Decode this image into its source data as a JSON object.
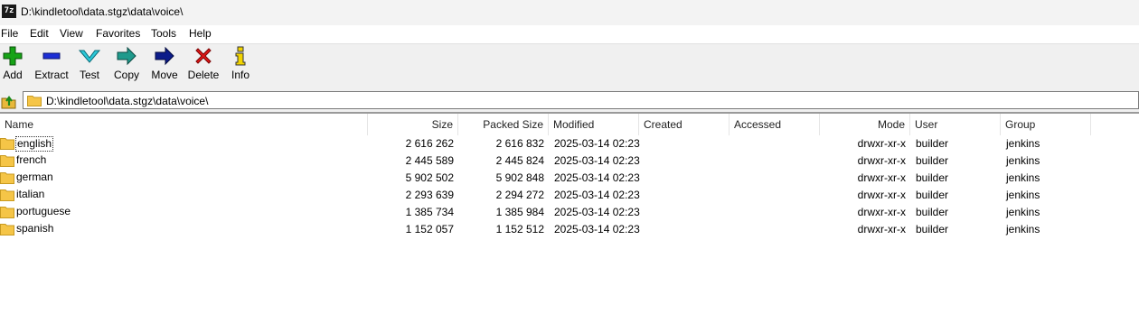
{
  "window": {
    "icon_text": "7z",
    "title": "D:\\kindletool\\data.stgz\\data\\voice\\"
  },
  "menu": [
    "File",
    "Edit",
    "View",
    "Favorites",
    "Tools",
    "Help"
  ],
  "toolbar": [
    {
      "label": "Add",
      "icon": "plus-icon",
      "color": "#16a316"
    },
    {
      "label": "Extract",
      "icon": "minus-icon",
      "color": "#1d2fd6"
    },
    {
      "label": "Test",
      "icon": "checkmark-icon",
      "color": "#2bc8d8"
    },
    {
      "label": "Copy",
      "icon": "copy-arrow-icon",
      "color": "#1f9a8c"
    },
    {
      "label": "Move",
      "icon": "move-arrow-icon",
      "color": "#0c1c8a"
    },
    {
      "label": "Delete",
      "icon": "delete-x-icon",
      "color": "#e01414"
    },
    {
      "label": "Info",
      "icon": "info-icon",
      "color": "#f2d400"
    }
  ],
  "address": {
    "path": "D:\\kindletool\\data.stgz\\data\\voice\\"
  },
  "columns": [
    "Name",
    "Size",
    "Packed Size",
    "Modified",
    "Created",
    "Accessed",
    "Mode",
    "User",
    "Group"
  ],
  "rows": [
    {
      "name": "english",
      "size": "2 616 262",
      "packed": "2 616 832",
      "modified": "2025-03-14 02:23",
      "created": "",
      "accessed": "",
      "mode": "drwxr-xr-x",
      "user": "builder",
      "group": "jenkins"
    },
    {
      "name": "french",
      "size": "2 445 589",
      "packed": "2 445 824",
      "modified": "2025-03-14 02:23",
      "created": "",
      "accessed": "",
      "mode": "drwxr-xr-x",
      "user": "builder",
      "group": "jenkins"
    },
    {
      "name": "german",
      "size": "5 902 502",
      "packed": "5 902 848",
      "modified": "2025-03-14 02:23",
      "created": "",
      "accessed": "",
      "mode": "drwxr-xr-x",
      "user": "builder",
      "group": "jenkins"
    },
    {
      "name": "italian",
      "size": "2 293 639",
      "packed": "2 294 272",
      "modified": "2025-03-14 02:23",
      "created": "",
      "accessed": "",
      "mode": "drwxr-xr-x",
      "user": "builder",
      "group": "jenkins"
    },
    {
      "name": "portuguese",
      "size": "1 385 734",
      "packed": "1 385 984",
      "modified": "2025-03-14 02:23",
      "created": "",
      "accessed": "",
      "mode": "drwxr-xr-x",
      "user": "builder",
      "group": "jenkins"
    },
    {
      "name": "spanish",
      "size": "1 152 057",
      "packed": "1 152 512",
      "modified": "2025-03-14 02:23",
      "created": "",
      "accessed": "",
      "mode": "drwxr-xr-x",
      "user": "builder",
      "group": "jenkins"
    }
  ]
}
